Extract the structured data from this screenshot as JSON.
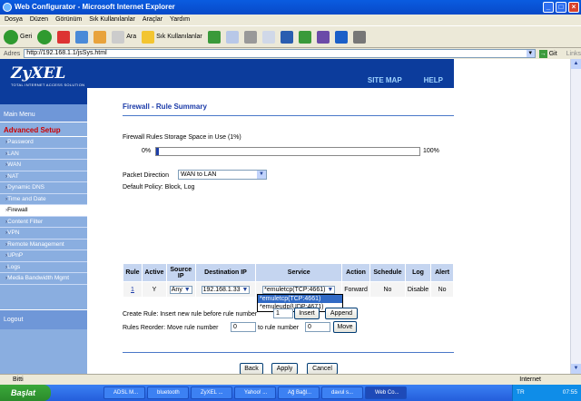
{
  "window": {
    "title": "Web Configurator - Microsoft Internet Explorer"
  },
  "menu": [
    "Dosya",
    "Düzen",
    "Görünüm",
    "Sık Kullanılanlar",
    "Araçlar",
    "Yardım"
  ],
  "toolbar": {
    "back": "Geri",
    "search": "Ara",
    "favorites": "Sık Kullanılanlar"
  },
  "address": {
    "label": "Adres",
    "url": "http://192.168.1.1/jsSys.html",
    "go": "Git",
    "links": "Links"
  },
  "sidebar": {
    "logo": "ZyXEL",
    "logo_sub": "TOTAL INTERNET ACCESS SOLUTION",
    "main_menu": "Main Menu",
    "section": "Advanced Setup",
    "items": [
      "Password",
      "LAN",
      "WAN",
      "NAT",
      "Dynamic DNS",
      "Time and Date",
      "Firewall",
      "Content Filter",
      "VPN",
      "Remote Management",
      "UPnP",
      "Logs",
      "Media Bandwidth Mgmt"
    ],
    "logout": "Logout"
  },
  "header": {
    "site_map": "SITE MAP",
    "help": "HELP"
  },
  "page": {
    "title": "Firewall - Rule Summary",
    "storage_label": "Firewall Rules Storage Space in Use",
    "storage_pct": "(1%)",
    "storage_min": "0%",
    "storage_max": "100%",
    "storage_fraction": 0.01,
    "packet_direction_label": "Packet Direction",
    "packet_direction_value": "WAN to LAN",
    "default_policy": "Default Policy: Block, Log"
  },
  "table": {
    "headers": [
      "Rule",
      "Active",
      "Source IP",
      "Destination IP",
      "Service",
      "Action",
      "Schedule",
      "Log",
      "Alert"
    ],
    "row": {
      "rule": "1",
      "active": "Y",
      "source": "Any",
      "dest": "192.168.1.33",
      "service": "*emuletcp(TCP:4661)",
      "action": "Forward",
      "schedule": "No",
      "log": "Disable",
      "alert": "No"
    },
    "service_options": [
      "*emuletcp(TCP:4661)",
      "*emuleudp(UDP:4671)"
    ]
  },
  "create_rule": {
    "label": "Create Rule: Insert new rule before rule number",
    "value": "1",
    "insert": "Insert",
    "append": "Append"
  },
  "reorder": {
    "label": "Rules Reorder: Move rule number",
    "from": "0",
    "to_label": "to rule number",
    "to": "0",
    "move": "Move"
  },
  "buttons": {
    "back": "Back",
    "apply": "Apply",
    "cancel": "Cancel"
  },
  "status": {
    "left": "Bitti",
    "zone": "Internet"
  },
  "taskbar": {
    "start": "Başlat",
    "tasks": [
      "ADSL M...",
      "bluetooth",
      "ZyXEL ...",
      "Yahoo! ...",
      "Ağ Bağl...",
      "davul s...",
      "Web Co..."
    ],
    "lang": "TR",
    "time": "07:55"
  }
}
